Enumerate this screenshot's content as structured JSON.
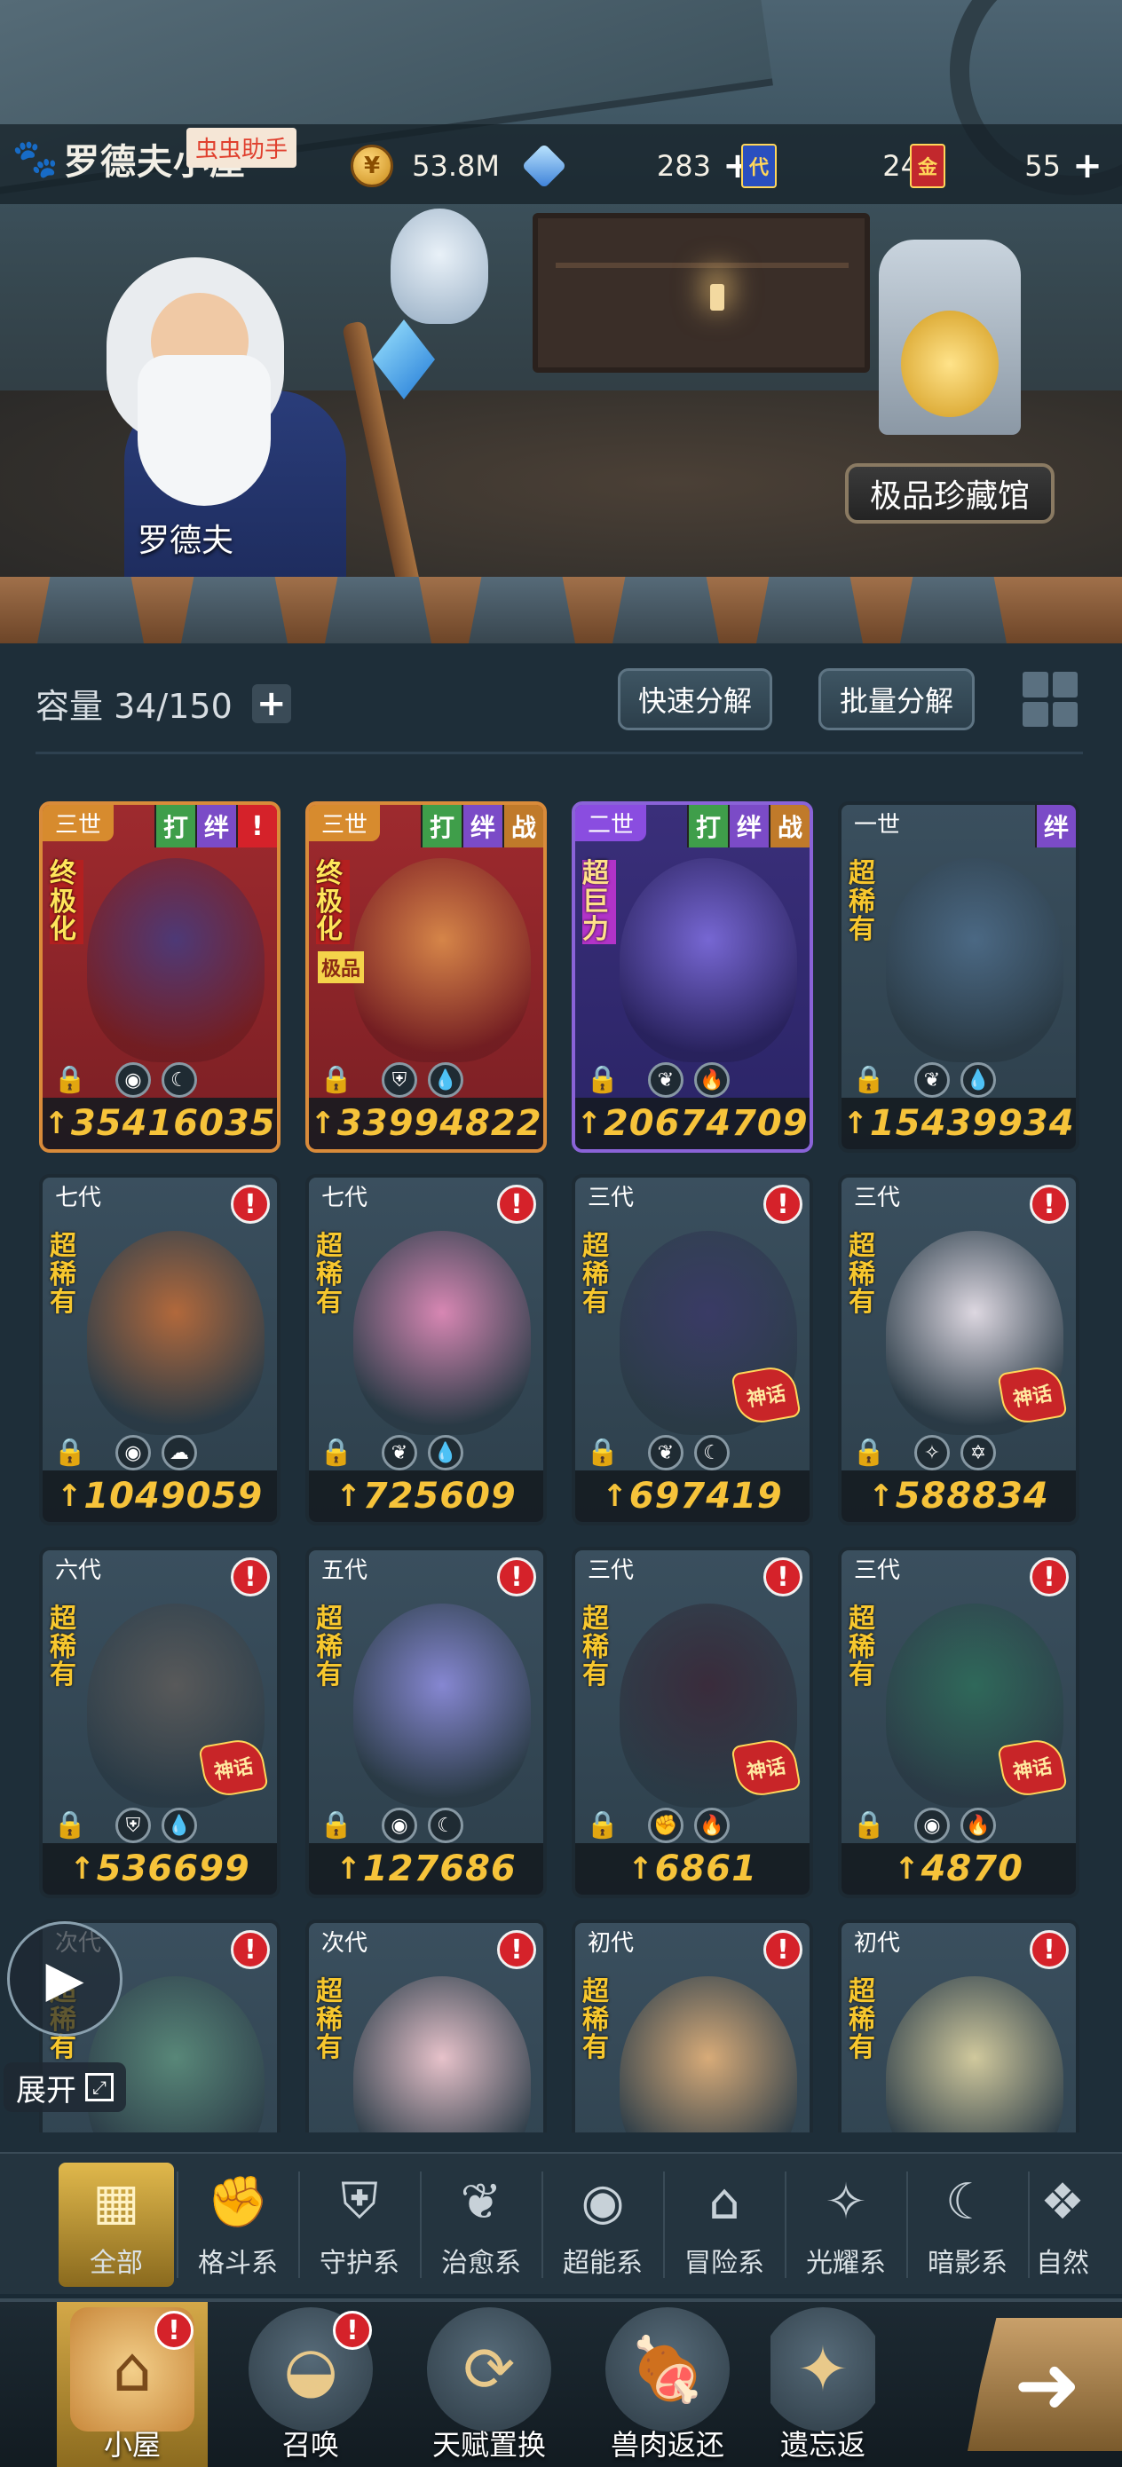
{
  "header": {
    "player_name": "罗德夫小屋",
    "helper_tag": "虫虫助手",
    "resources": [
      {
        "icon": "gold-coin-icon",
        "value": "53.8M",
        "has_plus": false
      },
      {
        "icon": "crystal-icon",
        "value": "283",
        "has_plus": true
      },
      {
        "icon": "blue-ticket-icon",
        "glyph": "代",
        "value": "24",
        "has_plus": false
      },
      {
        "icon": "gold-ticket-icon",
        "glyph": "金",
        "value": "55",
        "has_plus": true
      }
    ]
  },
  "scene": {
    "npc_name": "罗德夫",
    "museum_label": "极品珍藏馆"
  },
  "inventory": {
    "capacity_label": "容量 34/150",
    "quick_decompose": "快速分解",
    "batch_decompose": "批量分解"
  },
  "cards": [
    {
      "gen": "三世",
      "style": "red",
      "tags": [
        "打",
        "绊"
      ],
      "alert": true,
      "rarity": "终极化",
      "sub": "",
      "elements": [
        "◉",
        "☾"
      ],
      "power": "35416035",
      "myth": false,
      "color": "#4a3a7a"
    },
    {
      "gen": "三世",
      "style": "red",
      "tags": [
        "打",
        "绊",
        "战"
      ],
      "alert": false,
      "rarity": "终极化",
      "sub": "极品",
      "elements": [
        "⛨",
        "💧"
      ],
      "power": "33994822",
      "myth": false,
      "color": "#d98a4a"
    },
    {
      "gen": "二世",
      "style": "purple",
      "tags": [
        "打",
        "绊",
        "战"
      ],
      "alert": false,
      "rarity": "超巨力",
      "sub": "",
      "elements": [
        "❦",
        "🔥"
      ],
      "power": "20674709",
      "myth": false,
      "color": "#7a6ad8"
    },
    {
      "gen": "一世",
      "style": "slate",
      "tags": [
        "绊"
      ],
      "alert": false,
      "rarity": "超稀有",
      "sub": "",
      "elements": [
        "❦",
        "💧"
      ],
      "power": "15439934",
      "myth": false,
      "color": "#4c6a86"
    },
    {
      "gen": "七代",
      "style": "slate",
      "tags": [],
      "alert": true,
      "rarity": "超稀有",
      "sub": "",
      "elements": [
        "◉",
        "☁"
      ],
      "power": "1049059",
      "myth": false,
      "color": "#b86a3a"
    },
    {
      "gen": "七代",
      "style": "slate",
      "tags": [],
      "alert": true,
      "rarity": "超稀有",
      "sub": "",
      "elements": [
        "❦",
        "💧"
      ],
      "power": "725609",
      "myth": false,
      "color": "#e08ab8"
    },
    {
      "gen": "三代",
      "style": "slate",
      "tags": [],
      "alert": true,
      "rarity": "超稀有",
      "sub": "",
      "elements": [
        "❦",
        "☾"
      ],
      "power": "697419",
      "myth": true,
      "color": "#3a3a66"
    },
    {
      "gen": "三代",
      "style": "slate",
      "tags": [],
      "alert": true,
      "rarity": "超稀有",
      "sub": "",
      "elements": [
        "✧",
        "✡"
      ],
      "power": "588834",
      "myth": true,
      "color": "#e6dfe8"
    },
    {
      "gen": "六代",
      "style": "slate",
      "tags": [],
      "alert": true,
      "rarity": "超稀有",
      "sub": "",
      "elements": [
        "⛨",
        "💧"
      ],
      "power": "536699",
      "myth": true,
      "color": "#5a5a5a"
    },
    {
      "gen": "五代",
      "style": "slate",
      "tags": [],
      "alert": true,
      "rarity": "超稀有",
      "sub": "",
      "elements": [
        "◉",
        "☾"
      ],
      "power": "127686",
      "myth": false,
      "color": "#8a8ad8"
    },
    {
      "gen": "三代",
      "style": "slate",
      "tags": [],
      "alert": true,
      "rarity": "超稀有",
      "sub": "",
      "elements": [
        "✊",
        "🔥"
      ],
      "power": "6861",
      "myth": true,
      "color": "#3a2a3a"
    },
    {
      "gen": "三代",
      "style": "slate",
      "tags": [],
      "alert": true,
      "rarity": "超稀有",
      "sub": "",
      "elements": [
        "◉",
        "🔥"
      ],
      "power": "4870",
      "myth": true,
      "color": "#2f6a5a"
    },
    {
      "gen": "次代",
      "style": "slate",
      "tags": [],
      "alert": true,
      "rarity": "超稀有",
      "sub": "",
      "elements": [],
      "power": "",
      "myth": false,
      "color": "#5a8a7a"
    },
    {
      "gen": "次代",
      "style": "slate",
      "tags": [],
      "alert": true,
      "rarity": "超稀有",
      "sub": "",
      "elements": [],
      "power": "",
      "myth": false,
      "color": "#f0c8d0"
    },
    {
      "gen": "初代",
      "style": "slate",
      "tags": [],
      "alert": true,
      "rarity": "超稀有",
      "sub": "",
      "elements": [],
      "power": "",
      "myth": false,
      "color": "#e0b07a"
    },
    {
      "gen": "初代",
      "style": "slate",
      "tags": [],
      "alert": true,
      "rarity": "超稀有",
      "sub": "",
      "elements": [],
      "power": "",
      "myth": false,
      "color": "#d8cfa0"
    }
  ],
  "floating": {
    "expand_label": "展开"
  },
  "categories": [
    {
      "icon": "▦",
      "label": "全部",
      "active": true
    },
    {
      "icon": "✊",
      "label": "格斗系",
      "active": false
    },
    {
      "icon": "⛨",
      "label": "守护系",
      "active": false
    },
    {
      "icon": "❦",
      "label": "治愈系",
      "active": false
    },
    {
      "icon": "◉",
      "label": "超能系",
      "active": false
    },
    {
      "icon": "⌂",
      "label": "冒险系",
      "active": false
    },
    {
      "icon": "✧",
      "label": "光耀系",
      "active": false
    },
    {
      "icon": "☾",
      "label": "暗影系",
      "active": false
    },
    {
      "icon": "❖",
      "label": "自然",
      "active": false
    }
  ],
  "nav": [
    {
      "icon": "⌂",
      "label": "小屋",
      "active": true,
      "alert": true
    },
    {
      "icon": "◒",
      "label": "召唤",
      "active": false,
      "alert": true
    },
    {
      "icon": "⟳",
      "label": "天赋置换",
      "active": false,
      "alert": false
    },
    {
      "icon": "🍖",
      "label": "兽肉返还",
      "active": false,
      "alert": false
    },
    {
      "icon": "✦",
      "label": "遗忘返",
      "active": false,
      "alert": false
    }
  ],
  "power_symbol": "↑"
}
